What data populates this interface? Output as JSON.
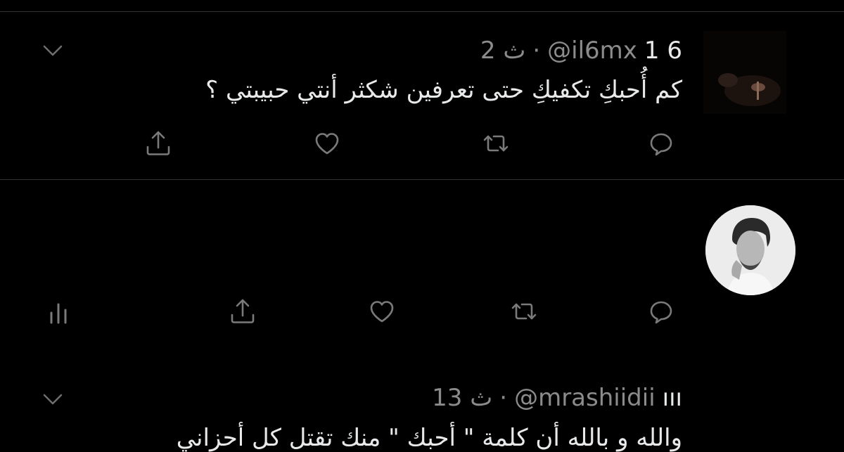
{
  "tweets": [
    {
      "name": "1 6",
      "handle": "@il6mx",
      "separator": "·",
      "time": "2 ث",
      "text": "كم أُحبكِ تكفيكِ حتى تعرفين شكثر أنتي حبيبتي ؟"
    },
    {
      "name": "ııı",
      "handle": "@mrashiidii",
      "separator": "·",
      "time": "13 ث",
      "text": "والله و بالله أن كلمة \" أحبك \" منك تقتل كل أحزاني"
    }
  ],
  "icons": {
    "reply": "reply-icon",
    "retweet": "retweet-icon",
    "like": "like-icon",
    "share": "share-icon",
    "analytics": "analytics-icon",
    "more": "chevron-down-icon"
  },
  "colors": {
    "background": "#000000",
    "text": "#e7e9ea",
    "muted": "#8b8b8b",
    "divider": "#2f3336"
  }
}
